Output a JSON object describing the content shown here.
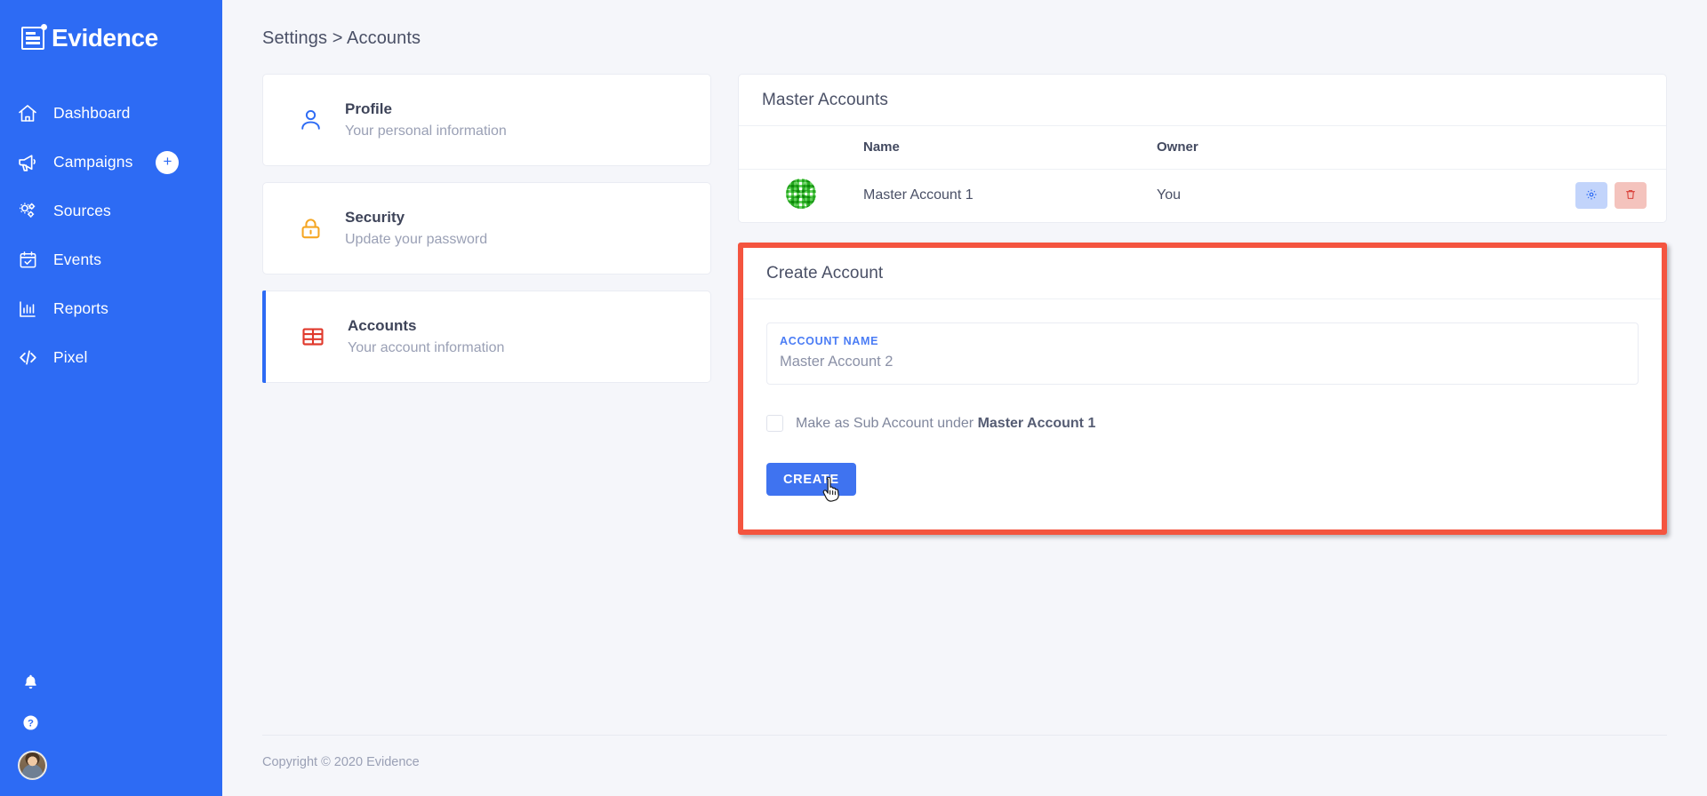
{
  "brand": {
    "logo_text": "Evidence",
    "accent": "#2d6bf4"
  },
  "sidebar": {
    "items": [
      {
        "label": "Dashboard",
        "icon": "home-icon"
      },
      {
        "label": "Campaigns",
        "icon": "megaphone-icon",
        "badge": "+"
      },
      {
        "label": "Sources",
        "icon": "gears-icon"
      },
      {
        "label": "Events",
        "icon": "calendar-check-icon"
      },
      {
        "label": "Reports",
        "icon": "bar-chart-icon"
      },
      {
        "label": "Pixel",
        "icon": "code-icon"
      }
    ],
    "bottom": [
      {
        "icon": "bell-icon"
      },
      {
        "icon": "help-circle-icon"
      },
      {
        "icon": "avatar"
      }
    ]
  },
  "breadcrumb": "Settings > Accounts",
  "settings_cards": [
    {
      "title": "Profile",
      "subtitle": "Your personal information",
      "icon": "user-icon",
      "color": "#2d6bf4",
      "active": false
    },
    {
      "title": "Security",
      "subtitle": "Update your password",
      "icon": "lock-icon",
      "color": "#f5a623",
      "active": false
    },
    {
      "title": "Accounts",
      "subtitle": "Your account information",
      "icon": "table-icon",
      "color": "#e0392c",
      "active": true
    }
  ],
  "master_accounts": {
    "title": "Master Accounts",
    "columns": [
      "",
      "Name",
      "Owner",
      ""
    ],
    "rows": [
      {
        "avatar": "identicon-green",
        "name": "Master Account 1",
        "owner": "You",
        "actions": [
          {
            "icon": "gear-icon",
            "name": "settings-button"
          },
          {
            "icon": "trash-icon",
            "name": "delete-button"
          }
        ]
      }
    ]
  },
  "create_account": {
    "title": "Create Account",
    "highlight_color": "#f4543f",
    "field": {
      "label": "ACCOUNT NAME",
      "value": "Master Account 2",
      "placeholder": "Account Name"
    },
    "checkbox": {
      "checked": false,
      "text_prefix": "Make as Sub Account under ",
      "text_bold": "Master Account 1"
    },
    "submit_label": "CREATE"
  },
  "footer": {
    "text": "Copyright © 2020 Evidence"
  }
}
